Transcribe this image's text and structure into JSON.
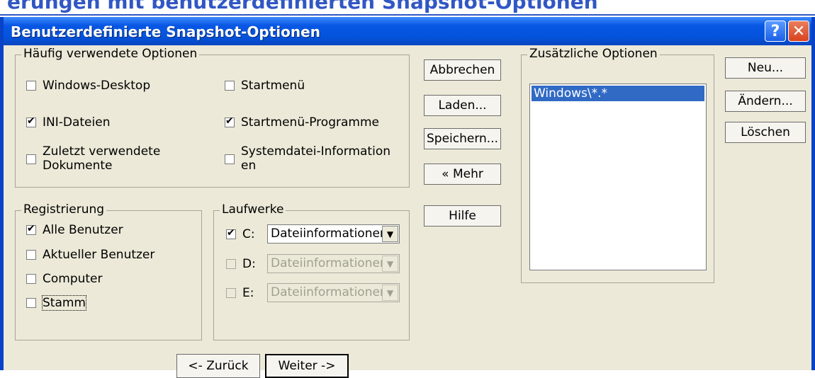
{
  "header_fragment": "erungen mit benutzerdefinierten Snapshot-Optionen",
  "window": {
    "title": "Benutzerdefinierte Snapshot-Optionen",
    "help_glyph": "?",
    "close_glyph": "✕"
  },
  "frequent": {
    "legend": "Häufig verwendete Optionen",
    "items": [
      {
        "label": "Windows-Desktop",
        "checked": false
      },
      {
        "label": "Startmenü",
        "checked": false
      },
      {
        "label": "INI-Dateien",
        "checked": true
      },
      {
        "label": "Startmenü-Programme",
        "checked": true
      },
      {
        "label": "Zuletzt verwendete Dokumente",
        "checked": false
      },
      {
        "label": "Systemdatei-Informationen",
        "checked": false
      }
    ]
  },
  "registry": {
    "legend": "Registrierung",
    "items": [
      {
        "label": "Alle Benutzer",
        "checked": true
      },
      {
        "label": "Aktueller Benutzer",
        "checked": false
      },
      {
        "label": "Computer",
        "checked": false
      },
      {
        "label": "Stamm",
        "checked": false
      }
    ]
  },
  "drives": {
    "legend": "Laufwerke",
    "items": [
      {
        "label": "C:",
        "checked": true,
        "enabled": true,
        "selected": "Dateiinformationen"
      },
      {
        "label": "D:",
        "checked": false,
        "enabled": false,
        "selected": "Dateiinformationen"
      },
      {
        "label": "E:",
        "checked": false,
        "enabled": false,
        "selected": "Dateiinformationen"
      }
    ]
  },
  "middle_buttons": {
    "cancel": "Abbrechen",
    "load": "Laden...",
    "save": "Speichern...",
    "more": "« Mehr",
    "help": "Hilfe"
  },
  "additional": {
    "legend": "Zusätzliche Optionen",
    "items": [
      "Windows\\*.*"
    ]
  },
  "right_buttons": {
    "new": "Neu...",
    "edit": "Ändern...",
    "delete": "Löschen"
  },
  "nav": {
    "back": "<- Zurück",
    "next": "Weiter ->"
  }
}
